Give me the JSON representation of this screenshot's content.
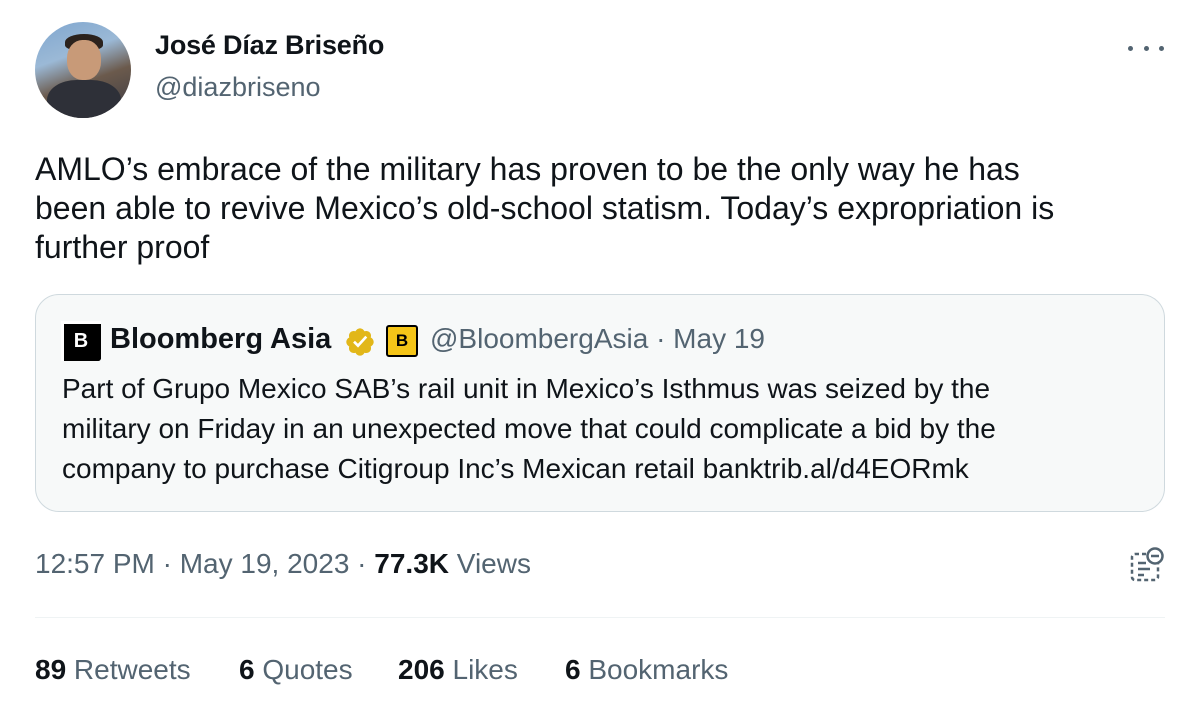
{
  "author": {
    "name": "José Díaz Briseño",
    "handle": "@diazbriseno"
  },
  "tweet_text": "AMLO’s embrace of the military has proven to be the only way he has\nbeen able to revive Mexico’s old-school statism. Today’s expropriation is\nfurther proof",
  "quoted": {
    "avatar_letter": "B",
    "name": "Bloomberg Asia",
    "badge_letter": "B",
    "meta": "@BloombergAsia · May 19",
    "text": "Part of Grupo Mexico SAB’s rail unit in Mexico’s Isthmus was seized by the\nmilitary on Friday in an unexpected move that could complicate a bid by the\ncompany to purchase Citigroup Inc’s Mexican retail banktrib.al/d4EORmk"
  },
  "timestamp": {
    "time_date": "12:57 PM · May 19, 2023 · ",
    "views_count": "77.3K",
    "views_label": " Views"
  },
  "stats": {
    "retweets_count": "89",
    "retweets_label": " Retweets",
    "quotes_count": "6",
    "quotes_label": " Quotes",
    "likes_count": "206",
    "likes_label": " Likes",
    "bookmarks_count": "6",
    "bookmarks_label": " Bookmarks"
  },
  "colors": {
    "text": "#0f1419",
    "secondary": "#536471",
    "border": "#cfd9de",
    "verified_gold": "#e2b719"
  },
  "icons": {
    "more": "more-icon",
    "verified": "verified-icon",
    "analytics": "analytics-icon"
  }
}
